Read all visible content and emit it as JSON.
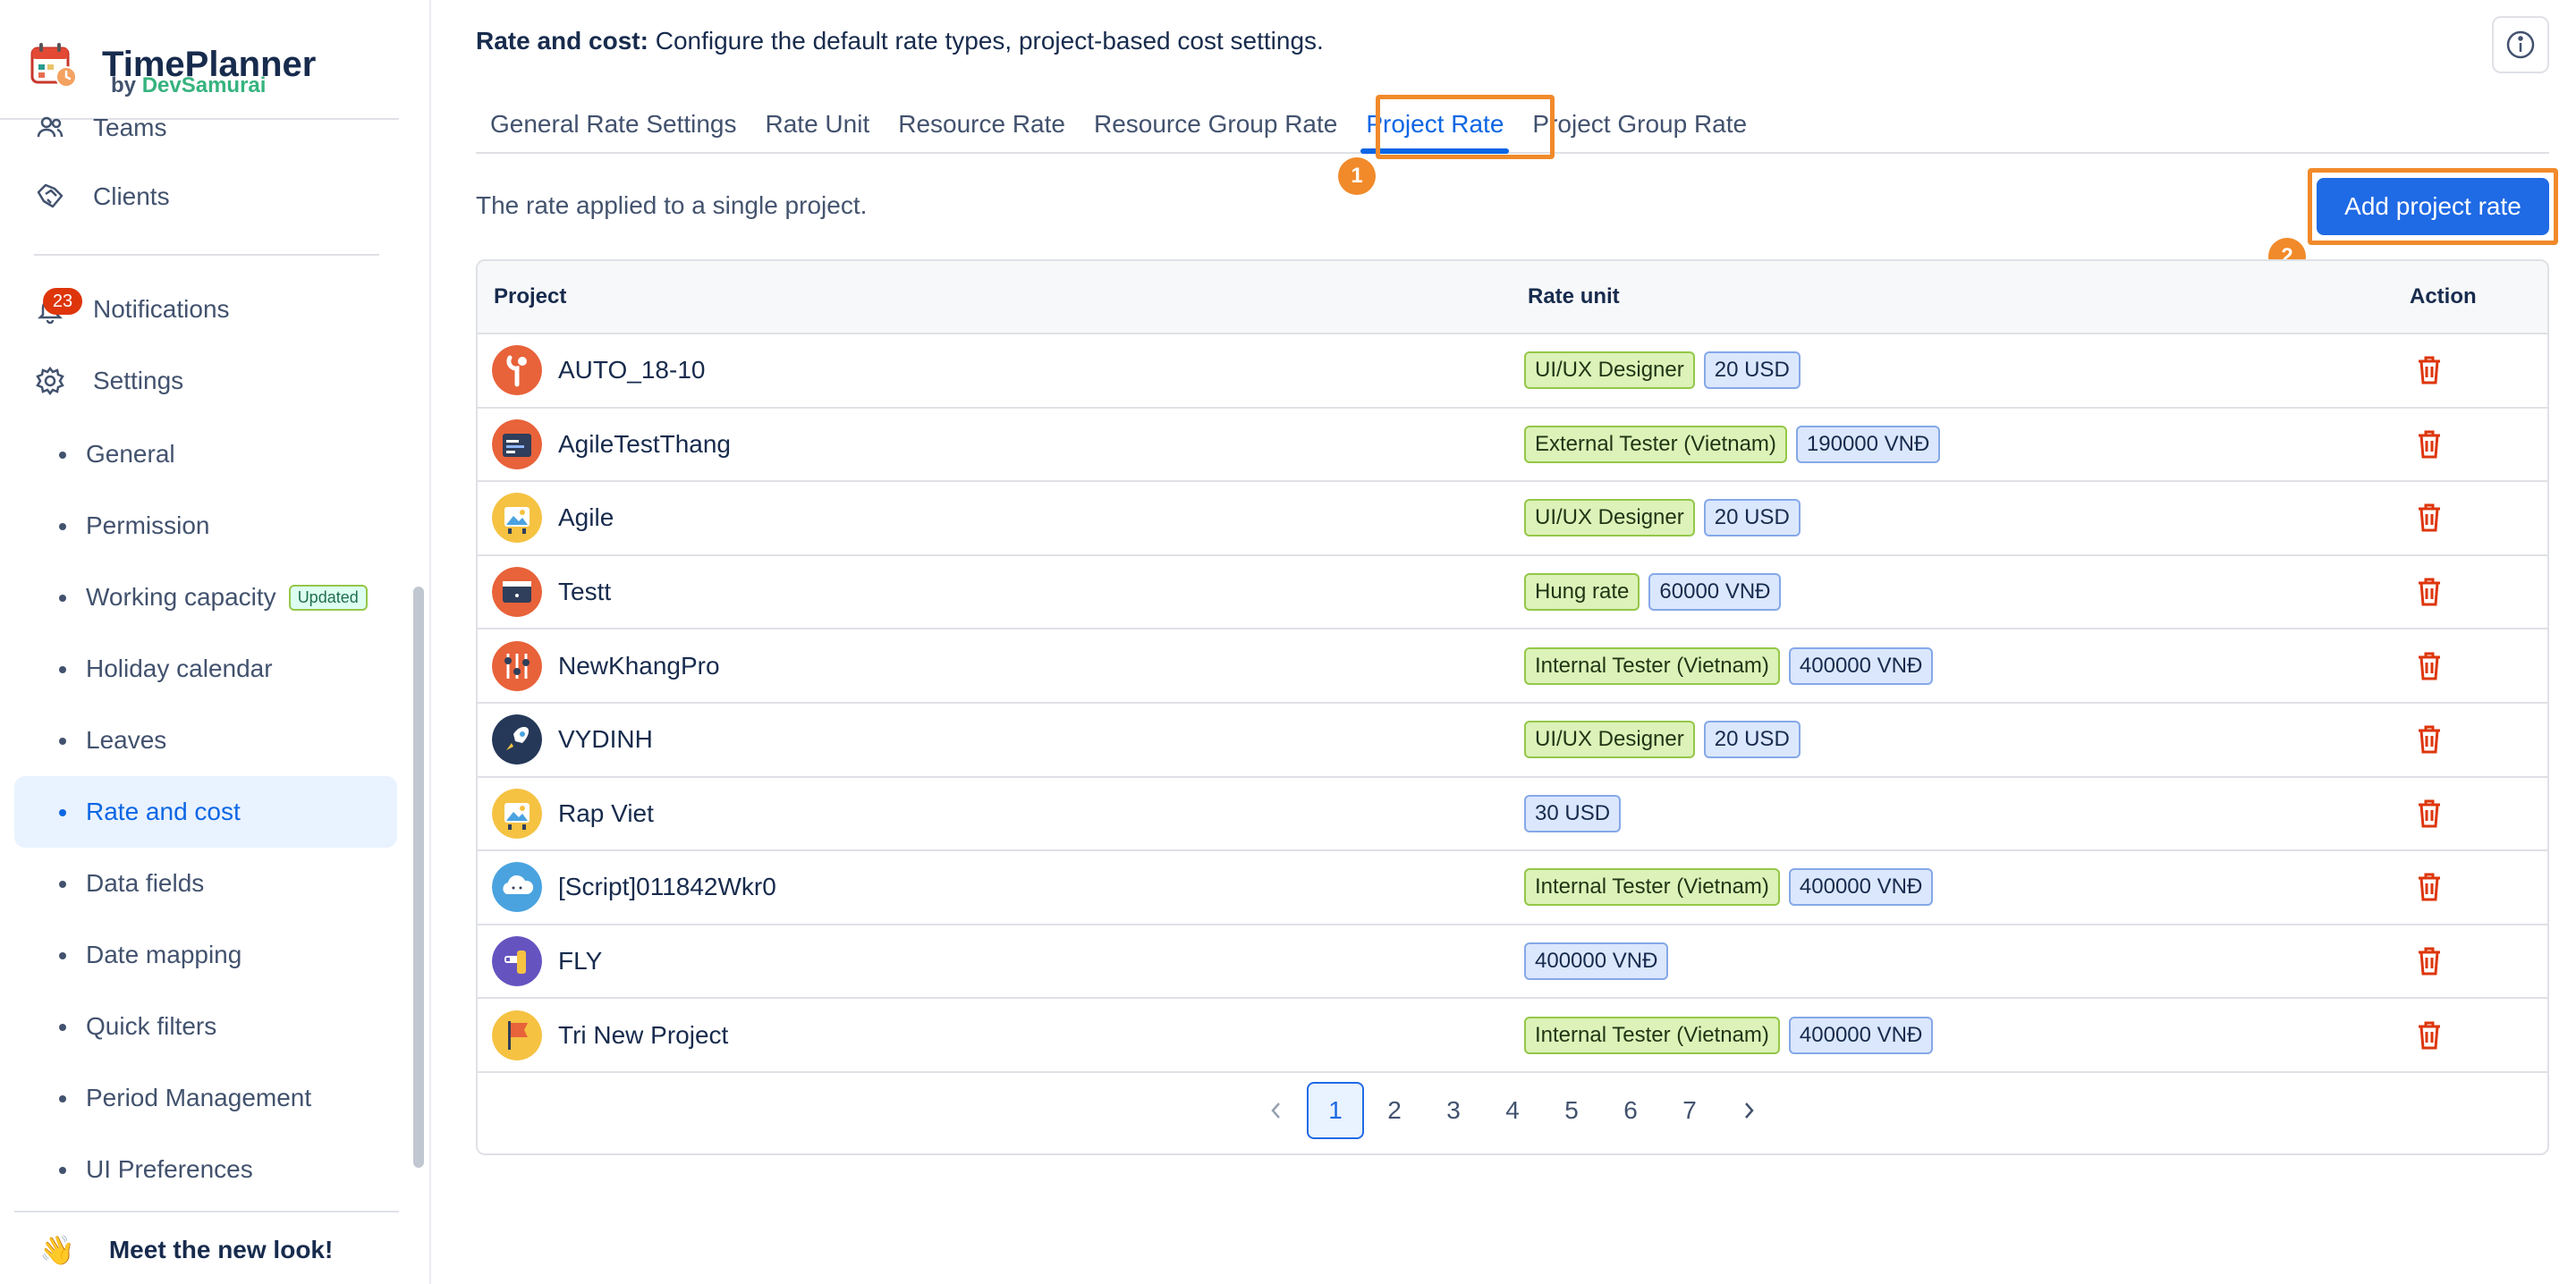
{
  "brand": {
    "title": "TimePlanner",
    "by": "by",
    "company": "DevSamurai"
  },
  "sidebar": {
    "items": [
      {
        "label": "Teams",
        "icon": "users-icon"
      },
      {
        "label": "Clients",
        "icon": "handshake-icon"
      },
      {
        "label": "Notifications",
        "icon": "bell-icon",
        "badge": "23"
      },
      {
        "label": "Settings",
        "icon": "gear-icon"
      }
    ],
    "settings_items": [
      {
        "label": "General"
      },
      {
        "label": "Permission"
      },
      {
        "label": "Working capacity",
        "tag": "Updated"
      },
      {
        "label": "Holiday calendar"
      },
      {
        "label": "Leaves"
      },
      {
        "label": "Rate and cost",
        "active": true
      },
      {
        "label": "Data fields"
      },
      {
        "label": "Date mapping"
      },
      {
        "label": "Quick filters"
      },
      {
        "label": "Period Management"
      },
      {
        "label": "UI Preferences"
      }
    ],
    "footer": {
      "emoji": "👋",
      "label": "Meet the new look!"
    }
  },
  "header": {
    "title_bold": "Rate and cost:",
    "title_rest": " Configure the default rate types, project-based cost settings."
  },
  "tabs": [
    {
      "label": "General Rate Settings"
    },
    {
      "label": "Rate Unit"
    },
    {
      "label": "Resource Rate"
    },
    {
      "label": "Resource Group Rate"
    },
    {
      "label": "Project Rate",
      "active": true
    },
    {
      "label": "Project Group Rate"
    }
  ],
  "annotations": {
    "one": "1",
    "two": "2"
  },
  "content": {
    "description": "The rate applied to a single project.",
    "add_button": "Add project rate"
  },
  "table": {
    "headers": {
      "project": "Project",
      "rate_unit": "Rate unit",
      "action": "Action"
    },
    "rows": [
      {
        "project": "AUTO_18-10",
        "avatar": "tools-avatar",
        "chips": [
          {
            "text": "UI/UX Designer",
            "kind": "green"
          },
          {
            "text": "20 USD",
            "kind": "blue"
          }
        ]
      },
      {
        "project": "AgileTestThang",
        "avatar": "code-avatar",
        "chips": [
          {
            "text": "External Tester (Vietnam)",
            "kind": "green"
          },
          {
            "text": "190000 VNĐ",
            "kind": "blue"
          }
        ]
      },
      {
        "project": "Agile",
        "avatar": "picture-avatar",
        "chips": [
          {
            "text": "UI/UX Designer",
            "kind": "green"
          },
          {
            "text": "20 USD",
            "kind": "blue"
          }
        ]
      },
      {
        "project": "Testt",
        "avatar": "browser-avatar",
        "chips": [
          {
            "text": "Hung rate",
            "kind": "green"
          },
          {
            "text": "60000 VNĐ",
            "kind": "blue"
          }
        ]
      },
      {
        "project": "NewKhangPro",
        "avatar": "sliders-avatar",
        "chips": [
          {
            "text": "Internal Tester (Vietnam)",
            "kind": "green"
          },
          {
            "text": "400000 VNĐ",
            "kind": "blue"
          }
        ]
      },
      {
        "project": "VYDINH",
        "avatar": "rocket-avatar",
        "chips": [
          {
            "text": "UI/UX Designer",
            "kind": "green"
          },
          {
            "text": "20 USD",
            "kind": "blue"
          }
        ]
      },
      {
        "project": "Rap Viet",
        "avatar": "picture-avatar",
        "chips": [
          {
            "text": "30 USD",
            "kind": "blue"
          }
        ]
      },
      {
        "project": "[Script]011842Wkr0",
        "avatar": "cloud-avatar",
        "chips": [
          {
            "text": "Internal Tester (Vietnam)",
            "kind": "green"
          },
          {
            "text": "400000 VNĐ",
            "kind": "blue"
          }
        ]
      },
      {
        "project": "FLY",
        "avatar": "plane-avatar",
        "chips": [
          {
            "text": "400000 VNĐ",
            "kind": "blue"
          }
        ]
      },
      {
        "project": "Tri New Project",
        "avatar": "flag-avatar",
        "chips": [
          {
            "text": "Internal Tester (Vietnam)",
            "kind": "green"
          },
          {
            "text": "400000 VNĐ",
            "kind": "blue"
          }
        ]
      }
    ]
  },
  "pagination": {
    "pages": [
      "1",
      "2",
      "3",
      "4",
      "5",
      "6",
      "7"
    ],
    "current": "1"
  },
  "colors": {
    "accent": "#1f6ae5",
    "highlight": "#f18a2a",
    "danger": "#de350b"
  }
}
